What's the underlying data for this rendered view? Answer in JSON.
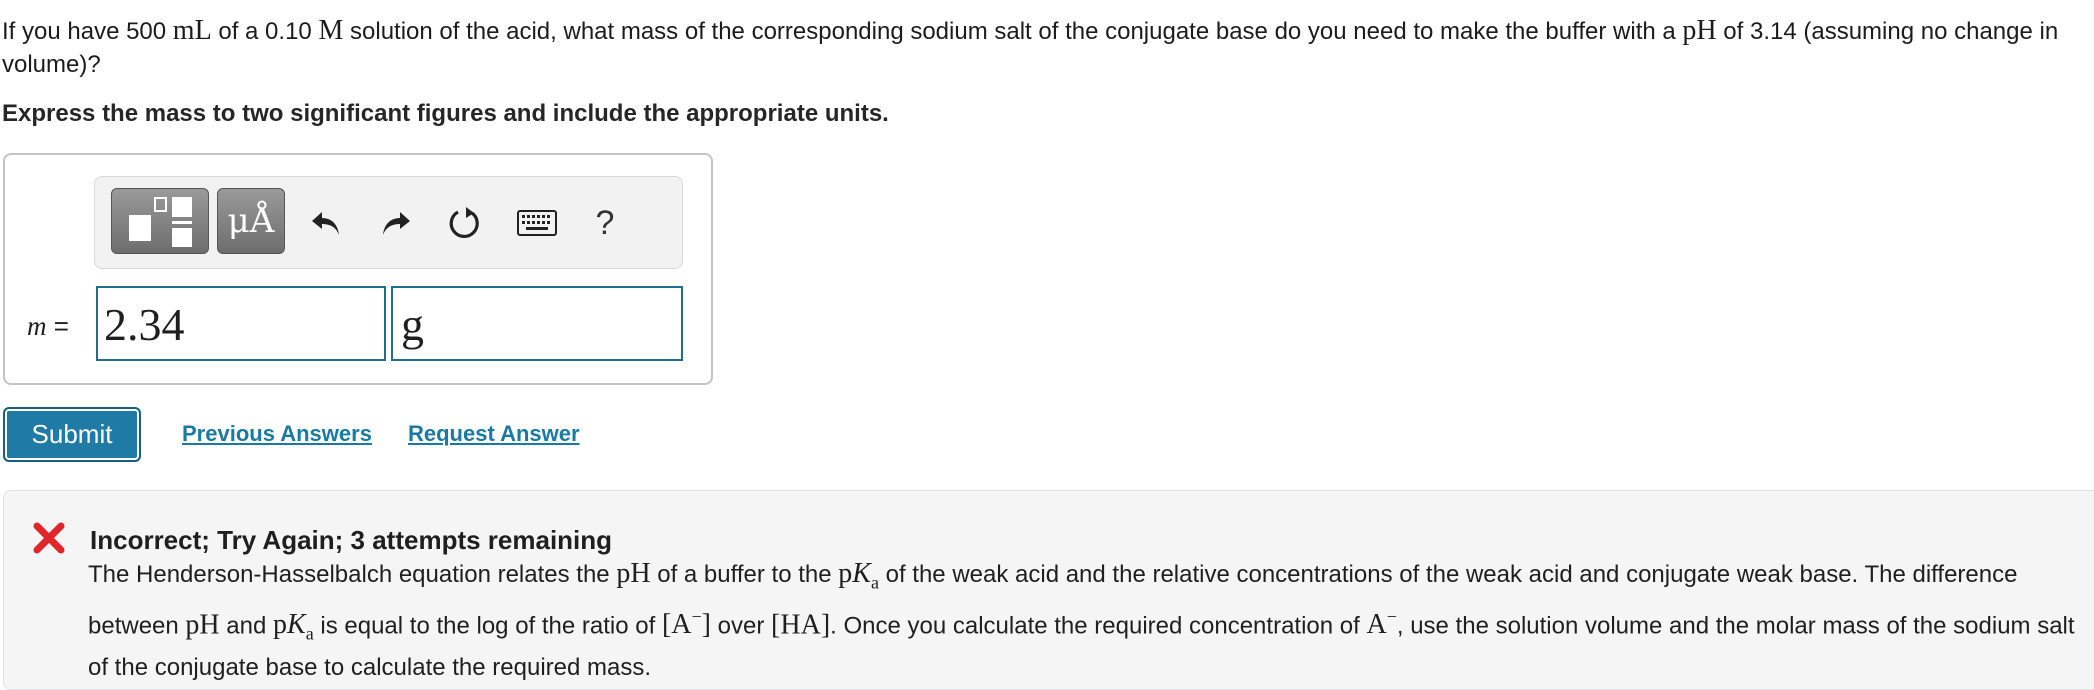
{
  "question": {
    "p1": "If you have 500 ",
    "u_ml": "mL",
    "p2": " of a 0.10 ",
    "u_m": "M",
    "p3": " solution of the acid, what mass of the corresponding sodium salt of the conjugate base do you need to make the buffer with a ",
    "u_ph": "pH",
    "p4": " of 3.14 (assuming no change in volume)?"
  },
  "instruction": "Express the mass to two significant figures and include the appropriate units.",
  "toolbar": {
    "units_label": "μÅ",
    "help_label": "?"
  },
  "answer": {
    "var": "m",
    "eq": " =",
    "value": "2.34",
    "unit": "g"
  },
  "actions": {
    "submit": "Submit",
    "previous": "Previous Answers",
    "request": "Request Answer"
  },
  "feedback": {
    "title": "Incorrect; Try Again; 3 attempts remaining",
    "t1": "The Henderson-Hasselbalch equation relates the ",
    "ph": "pH",
    "t2": " of a buffer to the ",
    "pka_p": "p",
    "pka_k": "K",
    "pka_a": "a",
    "t3": " of the weak acid and the relative concentrations of the weak acid and conjugate weak base. The difference between ",
    "t4": " and ",
    "t5": " is equal to the log of the ratio of ",
    "a_minus": "A",
    "minus": "−",
    "t6": " over ",
    "ha": "HA",
    "t7": ". Once you calculate the required concentration of ",
    "t8": ", use the solution volume and the molar mass of the sodium salt of the conjugate base to calculate the required mass."
  },
  "colors": {
    "accent": "#1f7ba6",
    "link": "#1a7aa3",
    "error": "#e0252b"
  }
}
